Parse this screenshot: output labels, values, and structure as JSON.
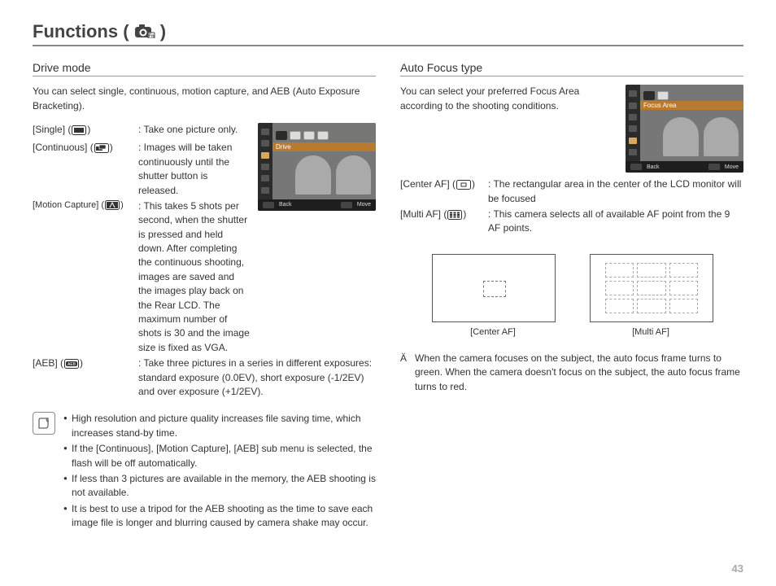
{
  "page_number": "43",
  "title_prefix": "Functions (",
  "title_suffix": " )",
  "left": {
    "heading": "Drive mode",
    "intro": "You can select single, continuous, motion capture, and AEB (Auto Exposure Bracketing).",
    "items": [
      {
        "term": "[Single]",
        "desc": "Take one picture only."
      },
      {
        "term": "[Continuous]",
        "desc": "Images will be taken continuously until the shutter button is released."
      },
      {
        "term": "[Motion Capture]",
        "desc": "This takes 5 shots per second, when the shutter is pressed and held down. After completing the continuous shooting, images are saved and the images play back on the Rear LCD. The maximum number of shots is 30 and the image size is fixed as VGA."
      },
      {
        "term": "[AEB]",
        "desc": "Take three pictures in a series in different exposures: standard exposure (0.0EV), short exposure (-1/2EV) and over exposure (+1/2EV)."
      }
    ],
    "notes": [
      "High resolution and picture quality increases file saving time, which increases stand-by time.",
      "If the [Continuous], [Motion Capture], [AEB] sub menu is selected, the flash will be off automatically.",
      "If less than 3 pictures are available in the memory, the AEB shooting is not available.",
      "It is best to use a tripod for the AEB shooting as the time to save each image file is longer and blurring caused by camera shake may occur."
    ],
    "screenshot": {
      "banner": "Drive",
      "back": "Back",
      "move": "Move"
    }
  },
  "right": {
    "heading": "Auto Focus type",
    "intro": "You can select your preferred Focus Area according to the shooting conditions.",
    "items": [
      {
        "term": "[Center AF]",
        "desc": "The rectangular area in the center of the LCD monitor will be focused"
      },
      {
        "term": "[Multi AF]",
        "desc": "This camera selects all of available AF point from the 9 AF points."
      }
    ],
    "fig_center": "[Center AF]",
    "fig_multi": "[Multi AF]",
    "note_symbol": "Ä",
    "note": "When the camera focuses on the subject, the auto focus frame turns to green. When the camera doesn't focus on the subject, the auto focus frame turns to red.",
    "screenshot": {
      "banner": "Focus Area",
      "back": "Back",
      "move": "Move"
    }
  }
}
